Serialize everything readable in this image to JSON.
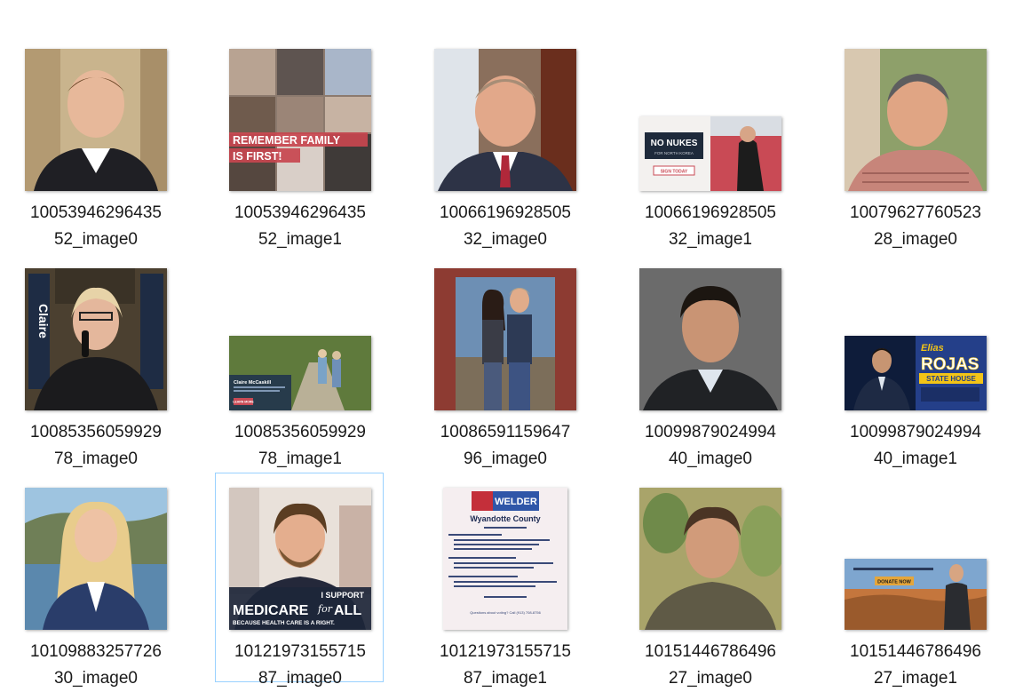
{
  "files": [
    {
      "line1": "10053946296435",
      "line2": "52_image0"
    },
    {
      "line1": "10053946296435",
      "line2": "52_image1",
      "overlay": [
        "REMEMBER FAMILY",
        "IS FIRST!"
      ]
    },
    {
      "line1": "10066196928505",
      "line2": "32_image0"
    },
    {
      "line1": "10066196928505",
      "line2": "32_image1",
      "overlay": [
        "NO NUKES",
        "FOR NORTH KOREA",
        "SIGN TODAY"
      ]
    },
    {
      "line1": "10079627760523",
      "line2": "28_image0"
    },
    {
      "line1": "10085356059929",
      "line2": "78_image0",
      "overlay": [
        "Claire"
      ]
    },
    {
      "line1": "10085356059929",
      "line2": "78_image1",
      "overlay": [
        "Claire McCaskill",
        "LEARN MORE"
      ]
    },
    {
      "line1": "10086591159647",
      "line2": "96_image0"
    },
    {
      "line1": "10099879024994",
      "line2": "40_image0"
    },
    {
      "line1": "10099879024994",
      "line2": "40_image1",
      "overlay": [
        "Elias",
        "ROJAS",
        "STATE HOUSE"
      ]
    },
    {
      "line1": "10109883257726",
      "line2": "30_image0"
    },
    {
      "line1": "10121973155715",
      "line2": "87_image0",
      "overlay": [
        "I SUPPORT",
        "MEDICARE",
        "for",
        "ALL",
        "BECAUSE HEALTH CARE IS A RIGHT."
      ]
    },
    {
      "line1": "10121973155715",
      "line2": "87_image1",
      "overlay": [
        "WELDER",
        "Wyandotte County",
        "Questions about voting? Call (913) 708-8756"
      ]
    },
    {
      "line1": "10151446786496",
      "line2": "27_image0"
    },
    {
      "line1": "10151446786496",
      "line2": "27_image1",
      "overlay": [
        "DONATE NOW"
      ]
    }
  ],
  "selected_index": 11,
  "colors": {
    "selection_border": "#99d1ff",
    "text": "#1a1a1a"
  }
}
